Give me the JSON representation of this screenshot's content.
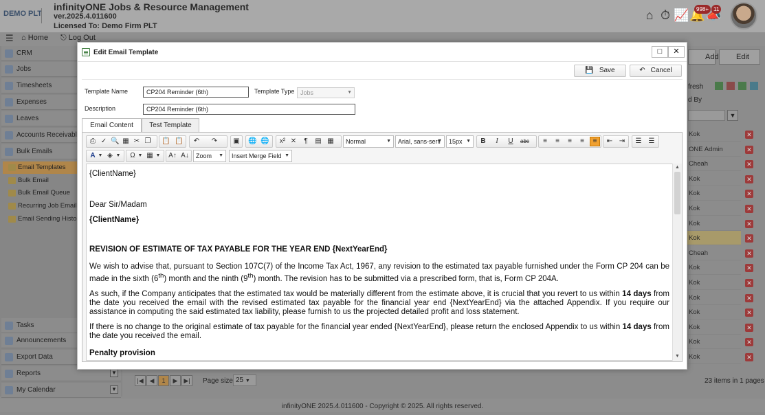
{
  "header": {
    "logo": "DEMO PLT",
    "title": "infinityONE Jobs & Resource Management",
    "version": "ver.2025.4.011600",
    "license": "Licensed To: Demo Firm PLT",
    "badges": {
      "notifications": "998+",
      "tasks": "11"
    },
    "icons": [
      "home-icon",
      "stopwatch-icon",
      "chart-icon",
      "bell-icon",
      "megaphone-icon"
    ]
  },
  "nav": {
    "home": "Home",
    "logout": "Log Out"
  },
  "sidebar": {
    "items": [
      {
        "label": "CRM"
      },
      {
        "label": "Jobs"
      },
      {
        "label": "Timesheets"
      },
      {
        "label": "Expenses"
      },
      {
        "label": "Leaves"
      },
      {
        "label": "Accounts Receivable"
      },
      {
        "label": "Bulk Emails"
      }
    ],
    "subitems": [
      {
        "label": "Email Templates"
      },
      {
        "label": "Bulk Email"
      },
      {
        "label": "Bulk Email Queue"
      },
      {
        "label": "Recurring Job Email ("
      },
      {
        "label": "Email Sending Histor"
      }
    ],
    "bottom": [
      {
        "label": "Tasks"
      },
      {
        "label": "Announcements"
      },
      {
        "label": "Export Data"
      },
      {
        "label": "Reports"
      },
      {
        "label": "My Calendar"
      }
    ]
  },
  "grid": {
    "add_label": "Add",
    "edit_label": "Edit",
    "refresh_label": "fresh",
    "column_header": "d By",
    "rows": [
      "Kok",
      "ONE Admin",
      "Cheah",
      "Kok",
      "Kok",
      "Kok",
      "Kok",
      "Kok",
      "Cheah",
      "Kok",
      "Kok",
      "Kok",
      "Kok",
      "Kok",
      "Kok",
      "Kok"
    ],
    "pager": {
      "page": "1",
      "page_size_label": "Page size:",
      "page_size": "25",
      "summary": "23 items in 1 pages"
    }
  },
  "footer": "infinityONE 2025.4.011600 - Copyright © 2025. All rights reserved.",
  "modal": {
    "title": "Edit Email Template",
    "save_label": "Save",
    "cancel_label": "Cancel",
    "template_name_label": "Template Name",
    "template_name": "CP204 Reminder (6th)",
    "template_type_label": "Template Type",
    "template_type": "Jobs",
    "description_label": "Description",
    "description": "CP204 Reminder (6th)",
    "tabs": [
      {
        "label": "Email Content"
      },
      {
        "label": "Test Template"
      }
    ],
    "editor": {
      "format": "Normal",
      "font": "Arial, sans-serif",
      "size": "15px",
      "zoom": "Zoom",
      "merge_field": "Insert Merge Field",
      "content": {
        "client1": "{ClientName}",
        "greeting": "Dear Sir/Madam",
        "client2": "{ClientName}",
        "heading": "REVISION OF ESTIMATE OF TAX PAYABLE FOR THE YEAR END {NextYearEnd}",
        "p1a": "We wish to advise that, pursuant to Section 107C(7) of the Income Tax Act, 1967, any revision to the estimated tax payable furnished under the Form CP 204 can be made in the sixth (6",
        "p1sup1": "th",
        "p1b": ") month and the ninth (9",
        "p1sup2": "th",
        "p1c": ") month. The revision has to be submitted via a prescribed form, that is, Form CP 204A.",
        "p2a": "As such, if the Company anticipates that the estimated tax would be materially different from the estimate above, it is crucial that you revert to us within ",
        "p2bold": "14 days",
        "p2b": " from the date you received the email with the revised estimated tax payable for the financial year end {NextYearEnd} via the attached Appendix.  If you require our assistance in computing the said estimated tax liability, please furnish to us the projected detailed profit and loss statement.",
        "p3a": "If there is no change to the original estimate of tax payable for the financial year ended {NextYearEnd}, please return the enclosed Appendix to us within ",
        "p3bold": "14 days",
        "p3b": " from the date you received the email.",
        "penalty": "Penalty provision"
      }
    }
  }
}
